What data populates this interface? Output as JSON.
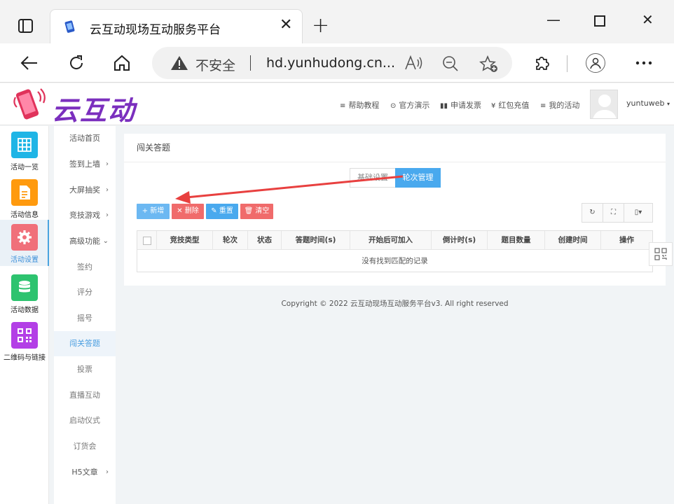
{
  "browser": {
    "tab_title": "云互动现场互动服务平台",
    "insecure_label": "不安全",
    "url": "hd.yunhudong.cn..."
  },
  "header": {
    "logo_text": "云互动",
    "nav": [
      {
        "icon": "list-icon",
        "label": "帮助教程"
      },
      {
        "icon": "play-circle-icon",
        "label": "官方演示"
      },
      {
        "icon": "card-icon",
        "label": "申请发票"
      },
      {
        "icon": "yen-icon",
        "label": "红包充值"
      },
      {
        "icon": "list-icon",
        "label": "我的活动"
      }
    ],
    "username": "yuntuweb"
  },
  "iconbar": {
    "items": [
      {
        "label": "活动一览",
        "icon": "grid-icon",
        "color": "#1fb5e6"
      },
      {
        "label": "活动信息",
        "icon": "document-icon",
        "color": "#ff9a0e"
      },
      {
        "label": "活动设置",
        "icon": "gear-icon",
        "color": "#f0707a"
      },
      {
        "label": "活动数据",
        "icon": "database-icon",
        "color": "#2dc36f"
      },
      {
        "label": "二维码与链接",
        "icon": "qrcode-icon",
        "color": "#b33fe6"
      }
    ]
  },
  "submenu": {
    "items": [
      {
        "label": "活动首页",
        "arrow": ""
      },
      {
        "label": "签到上墙",
        "arrow": "›"
      },
      {
        "label": "大屏抽奖",
        "arrow": "›"
      },
      {
        "label": "竞技游戏",
        "arrow": "›"
      },
      {
        "label": "高级功能",
        "arrow": "⌄"
      },
      {
        "label": "签约",
        "arrow": ""
      },
      {
        "label": "评分",
        "arrow": ""
      },
      {
        "label": "摇号",
        "arrow": ""
      },
      {
        "label": "闯关答题",
        "arrow": ""
      },
      {
        "label": "投票",
        "arrow": ""
      },
      {
        "label": "直播互动",
        "arrow": ""
      },
      {
        "label": "启动仪式",
        "arrow": ""
      },
      {
        "label": "订货会",
        "arrow": ""
      },
      {
        "label": "H5文章",
        "arrow": "›"
      }
    ]
  },
  "main": {
    "title": "闯关答题",
    "segments": {
      "basic": "基础设置",
      "round": "轮次管理"
    },
    "buttons": {
      "add": "+ 新增",
      "delete": "✕ 删除",
      "reset": "✎ 重置",
      "clear": "🗑 清空"
    },
    "toolbar": {
      "refresh": "↻",
      "fullscreen": "⛶",
      "columns": "▯▾"
    },
    "table": {
      "columns": [
        "竞技类型",
        "轮次",
        "状态",
        "答题时间(s)",
        "开始后可加入",
        "倒计时(s)",
        "题目数量",
        "创建时间",
        "操作"
      ],
      "empty_text": "没有找到匹配的记录"
    },
    "copyright": "Copyright © 2022 云互动现场互动服务平台v3. All right reserved"
  },
  "colors": {
    "accent": "#49a9ee",
    "danger": "#f06b6b",
    "arrow": "#e8403f"
  }
}
